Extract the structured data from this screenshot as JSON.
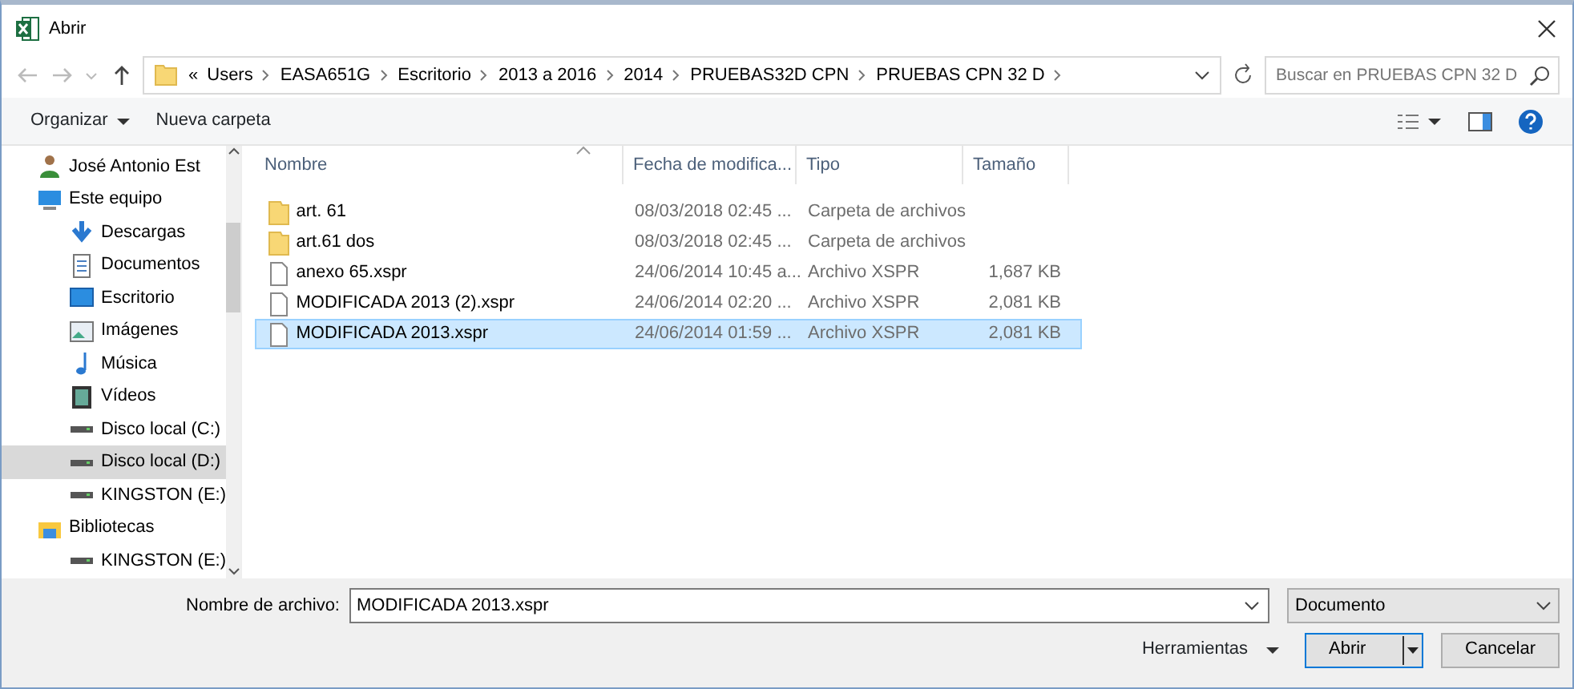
{
  "window": {
    "title": "Abrir"
  },
  "address": {
    "path": [
      "«",
      "Users",
      "EASA651G",
      "Escritorio",
      "2013 a 2016",
      "2014",
      "PRUEBAS32D CPN",
      "PRUEBAS CPN 32 D"
    ],
    "search_placeholder": "Buscar en PRUEBAS CPN 32 D"
  },
  "toolbar": {
    "organize": "Organizar",
    "new_folder": "Nueva carpeta"
  },
  "sidebar": {
    "items": [
      {
        "label": "José Antonio Est",
        "kind": "user",
        "selected": false
      },
      {
        "label": "Este equipo",
        "kind": "computer",
        "selected": false,
        "children": [
          {
            "label": "Descargas",
            "kind": "download",
            "selected": false
          },
          {
            "label": "Documentos",
            "kind": "document",
            "selected": false
          },
          {
            "label": "Escritorio",
            "kind": "desktop",
            "selected": false
          },
          {
            "label": "Imágenes",
            "kind": "image",
            "selected": false
          },
          {
            "label": "Música",
            "kind": "music",
            "selected": false
          },
          {
            "label": "Vídeos",
            "kind": "video",
            "selected": false
          },
          {
            "label": "Disco local (C:)",
            "kind": "drive",
            "selected": false
          },
          {
            "label": "Disco local (D:)",
            "kind": "drive",
            "selected": true
          },
          {
            "label": "KINGSTON (E:)",
            "kind": "drive",
            "selected": false
          }
        ]
      },
      {
        "label": "Bibliotecas",
        "kind": "library",
        "selected": false,
        "children": [
          {
            "label": "KINGSTON (E:)",
            "kind": "drive",
            "selected": false
          }
        ]
      }
    ]
  },
  "table": {
    "columns": [
      "Nombre",
      "Fecha de modifica...",
      "Tipo",
      "Tamaño"
    ],
    "rows": [
      {
        "kind": "folder",
        "name": "art. 61",
        "date": "08/03/2018 02:45 ...",
        "type": "Carpeta de archivos",
        "selected": false
      },
      {
        "kind": "folder",
        "name": "art.61 dos",
        "date": "08/03/2018 02:45 ...",
        "type": "Carpeta de archivos",
        "selected": false
      },
      {
        "kind": "file",
        "name": "anexo 65.xspr",
        "date": "24/06/2014 10:45 a...",
        "type": "Archivo XSPR",
        "size": "1,687 KB",
        "selected": false
      },
      {
        "kind": "file",
        "name": "MODIFICADA 2013 (2).xspr",
        "date": "24/06/2014 02:20 ...",
        "type": "Archivo XSPR",
        "size": "2,081 KB",
        "selected": false
      },
      {
        "kind": "file",
        "name": "MODIFICADA 2013.xspr",
        "date": "24/06/2014 01:59 ...",
        "type": "Archivo XSPR",
        "size": "2,081 KB",
        "selected": true
      }
    ]
  },
  "footer": {
    "filename_label": "Nombre de archivo:",
    "filename": "MODIFICADA 2013.xspr",
    "filter": "Documento",
    "tools": "Herramientas",
    "open": "Abrir",
    "cancel": "Cancelar"
  }
}
